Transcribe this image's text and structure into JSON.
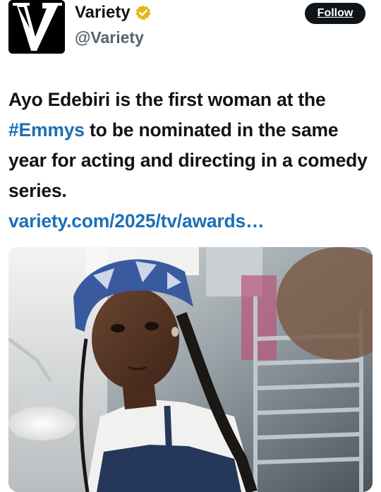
{
  "account": {
    "display_name": "Variety",
    "handle": "@Variety",
    "verified": true,
    "avatar_icon": "variety-v-logo-icon",
    "badge_icon": "verified-gold-badge-icon"
  },
  "follow_button": {
    "label": "Follow"
  },
  "tweet": {
    "text_part1": "Ayo Edebiri is the first woman at the ",
    "hashtag": "#Emmys",
    "text_part2": " to be nominated in the same year for acting and directing in a comedy series.",
    "link": "variety.com/2025/tv/awards…"
  },
  "media": {
    "kind": "photo",
    "description_icon": "photo-image"
  },
  "colors": {
    "link": "#1d6fb8",
    "text": "#0f1419",
    "secondary": "#536471",
    "badge_gold": "#e2b719"
  }
}
